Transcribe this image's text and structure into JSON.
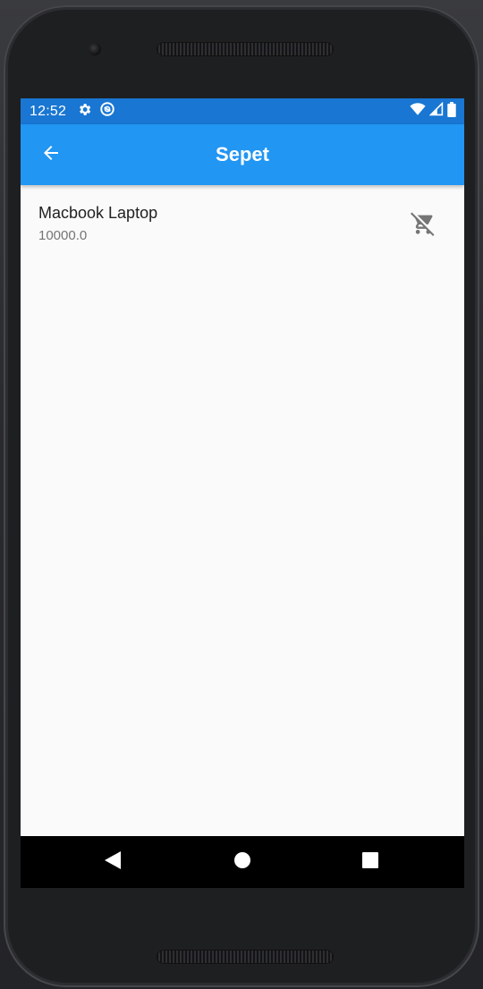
{
  "status_bar": {
    "time": "12:52",
    "icons": [
      "settings-gear-icon",
      "sync-icon",
      "wifi-icon",
      "signal-icon",
      "battery-icon"
    ]
  },
  "app_bar": {
    "title": "Sepet",
    "back_icon": "arrow-back-icon"
  },
  "cart": {
    "items": [
      {
        "name": "Macbook Laptop",
        "price": "10000.0",
        "action_icon": "remove-shopping-cart-icon"
      }
    ]
  },
  "nav_bar": {
    "buttons": [
      "back-triangle-icon",
      "home-circle-icon",
      "recents-square-icon"
    ]
  },
  "colors": {
    "status_bar": "#1976d2",
    "app_bar": "#2196f3",
    "background": "#fafafa",
    "icon_grey": "#757575"
  }
}
